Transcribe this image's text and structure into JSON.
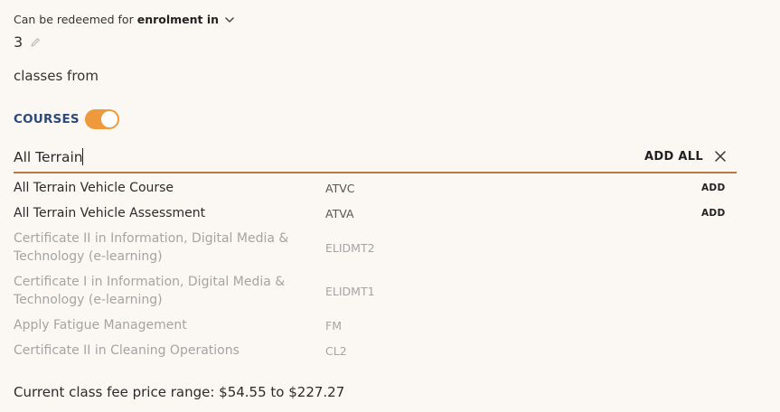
{
  "redeem": {
    "prefix": "Can be redeemed for",
    "selected": "enrolment in",
    "chevron_icon": "chevron-down-icon"
  },
  "count": {
    "value": "3",
    "edit_icon": "pencil-icon"
  },
  "classes_from": "classes from",
  "courses": {
    "label": "COURSES",
    "toggle_on": true,
    "toggle_color": "#ee9a3c"
  },
  "search": {
    "value": "All Terrain",
    "add_all_label": "ADD ALL",
    "clear_icon": "close-icon"
  },
  "results": [
    {
      "name": "All Terrain Vehicle Course",
      "code": "ATVC",
      "add_label": "ADD",
      "enabled": true
    },
    {
      "name": "All Terrain Vehicle Assessment",
      "code": "ATVA",
      "add_label": "ADD",
      "enabled": true
    },
    {
      "name": "Certificate II in Information, Digital Media & Technology (e-learning)",
      "code": "ELIDMT2",
      "add_label": "",
      "enabled": false
    },
    {
      "name": "Certificate I in Information, Digital Media & Technology (e-learning)",
      "code": "ELIDMT1",
      "add_label": "",
      "enabled": false
    },
    {
      "name": "Apply Fatigue Management",
      "code": "FM",
      "add_label": "",
      "enabled": false
    },
    {
      "name": "Certificate II in Cleaning Operations",
      "code": "CL2",
      "add_label": "",
      "enabled": false
    }
  ],
  "fee_range": "Current class fee price range: $54.55 to $227.27"
}
